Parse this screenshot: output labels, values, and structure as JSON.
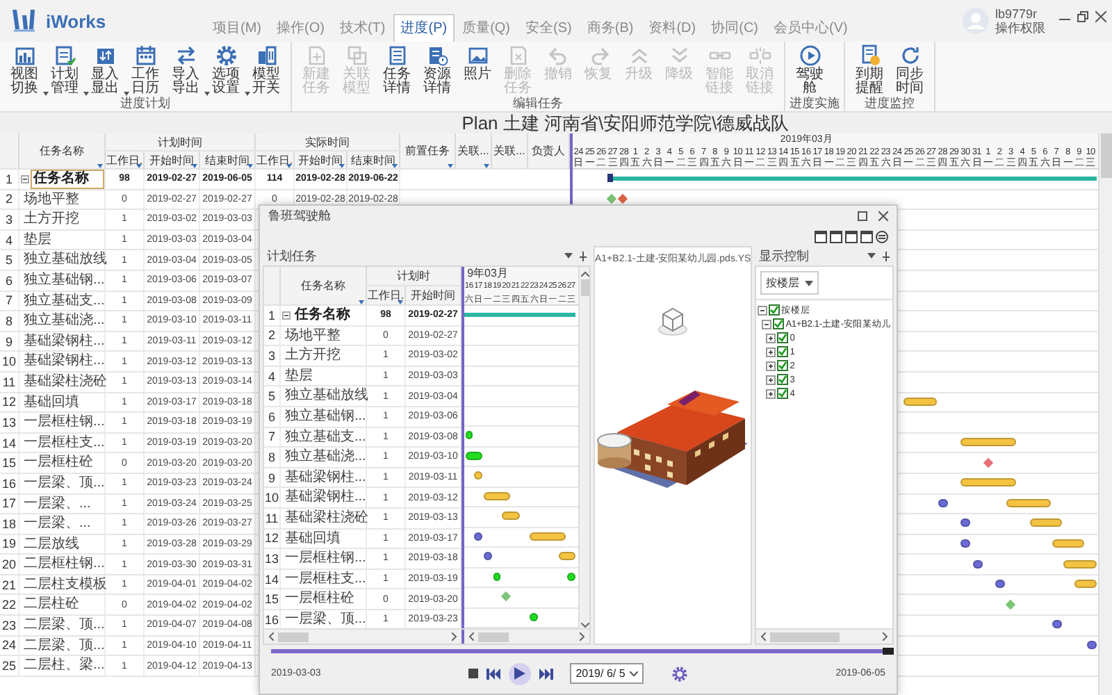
{
  "app": {
    "name": "iWorks"
  },
  "menu_tabs": [
    {
      "label": "项目(M)",
      "selected": false
    },
    {
      "label": "操作(O)",
      "selected": false
    },
    {
      "label": "技术(T)",
      "selected": false
    },
    {
      "label": "进度(P)",
      "selected": true
    },
    {
      "label": "质量(Q)",
      "selected": false
    },
    {
      "label": "安全(S)",
      "selected": false
    },
    {
      "label": "商务(B)",
      "selected": false
    },
    {
      "label": "资料(D)",
      "selected": false
    },
    {
      "label": "协同(C)",
      "selected": false
    },
    {
      "label": "会员中心(V)",
      "selected": false
    }
  ],
  "user": {
    "name": "lb9779r",
    "role": "操作权限"
  },
  "ribbon_groups": [
    {
      "label": "进度计划",
      "buttons": [
        {
          "label": "视图切换",
          "disabled": false,
          "dropdown": true
        },
        {
          "label": "计划管理",
          "disabled": false,
          "dropdown": true
        },
        {
          "label": "显入显出",
          "disabled": false,
          "dropdown": true
        },
        {
          "label": "工作日历",
          "disabled": false,
          "dropdown": false
        },
        {
          "label": "导入导出",
          "disabled": false,
          "dropdown": true
        },
        {
          "label": "选项设置",
          "disabled": false,
          "dropdown": true
        },
        {
          "label": "模型开关",
          "disabled": false,
          "dropdown": false
        }
      ]
    },
    {
      "label": "编辑任务",
      "buttons": [
        {
          "label": "新建任务",
          "disabled": true,
          "dropdown": false
        },
        {
          "label": "关联模型",
          "disabled": true,
          "dropdown": false
        },
        {
          "label": "任务详情",
          "disabled": false,
          "dropdown": false
        },
        {
          "label": "资源详情",
          "disabled": false,
          "dropdown": false
        },
        {
          "label": "照片",
          "disabled": false,
          "dropdown": false
        },
        {
          "label": "删除任务",
          "disabled": true,
          "dropdown": false
        },
        {
          "label": "撤销",
          "disabled": true,
          "dropdown": false
        },
        {
          "label": "恢复",
          "disabled": true,
          "dropdown": false
        },
        {
          "label": "升级",
          "disabled": true,
          "dropdown": false
        },
        {
          "label": "降级",
          "disabled": true,
          "dropdown": false
        },
        {
          "label": "智能链接",
          "disabled": true,
          "dropdown": false
        },
        {
          "label": "取消链接",
          "disabled": true,
          "dropdown": false
        }
      ]
    },
    {
      "label": "进度实施",
      "buttons": [
        {
          "label": "驾驶舱",
          "disabled": false,
          "dropdown": false
        }
      ]
    },
    {
      "label": "进度监控",
      "buttons": [
        {
          "label": "到期提醒",
          "disabled": false,
          "dropdown": false
        },
        {
          "label": "同步时间",
          "disabled": false,
          "dropdown": false
        }
      ]
    }
  ],
  "plan_title": "Plan 土建 河南省\\安阳师范学院\\德威战队",
  "plan_grid": {
    "columns": [
      {
        "kind": "number"
      },
      {
        "kind": "text",
        "label": "任务名称",
        "filter": true
      },
      {
        "kind": "group",
        "label": "计划时间",
        "children": [
          {
            "label": "工作日.",
            "filter": true
          },
          {
            "label": "开始时间",
            "filter": true
          },
          {
            "label": "结束时间",
            "filter": true
          }
        ]
      },
      {
        "kind": "group",
        "label": "实际时间",
        "children": [
          {
            "label": "工作日.",
            "filter": true
          },
          {
            "label": "开始时间",
            "filter": true
          },
          {
            "label": "结束时间",
            "filter": true
          }
        ]
      },
      {
        "kind": "text",
        "label": "前置任务",
        "filter": true
      },
      {
        "kind": "text",
        "label": "关联...",
        "filter": true
      },
      {
        "kind": "text",
        "label": "关联...",
        "filter": false
      },
      {
        "kind": "text",
        "label": "负责人",
        "filter": false
      }
    ],
    "timeline": {
      "months": [
        {
          "label": "2019年03月"
        }
      ],
      "days": [
        {
          "day": "24",
          "weekday": "日"
        },
        {
          "day": "25",
          "weekday": "一"
        },
        {
          "day": "26",
          "weekday": "二"
        },
        {
          "day": "27",
          "weekday": "三"
        },
        {
          "day": "28",
          "weekday": "四"
        },
        {
          "day": "1",
          "weekday": "五"
        },
        {
          "day": "2",
          "weekday": "六"
        },
        {
          "day": "3",
          "weekday": "日"
        },
        {
          "day": "4",
          "weekday": "一"
        },
        {
          "day": "5",
          "weekday": "二"
        },
        {
          "day": "6",
          "weekday": "三"
        },
        {
          "day": "7",
          "weekday": "四"
        },
        {
          "day": "8",
          "weekday": "五"
        },
        {
          "day": "9",
          "weekday": "六"
        },
        {
          "day": "10",
          "weekday": "日"
        },
        {
          "day": "11",
          "weekday": "一"
        },
        {
          "day": "12",
          "weekday": "二"
        },
        {
          "day": "13",
          "weekday": "三"
        },
        {
          "day": "14",
          "weekday": "四"
        },
        {
          "day": "15",
          "weekday": "五"
        },
        {
          "day": "16",
          "weekday": "六"
        },
        {
          "day": "17",
          "weekday": "日"
        },
        {
          "day": "18",
          "weekday": "一"
        },
        {
          "day": "19",
          "weekday": "二"
        },
        {
          "day": "20",
          "weekday": "三"
        },
        {
          "day": "21",
          "weekday": "四"
        },
        {
          "day": "22",
          "weekday": "五"
        },
        {
          "day": "23",
          "weekday": "六"
        },
        {
          "day": "24",
          "weekday": "日"
        },
        {
          "day": "25",
          "weekday": "一"
        },
        {
          "day": "26",
          "weekday": "二"
        },
        {
          "day": "27",
          "weekday": "三"
        },
        {
          "day": "28",
          "weekday": "四"
        },
        {
          "day": "29",
          "weekday": "五"
        },
        {
          "day": "30",
          "weekday": "六"
        },
        {
          "day": "31",
          "weekday": "日"
        },
        {
          "day": "1",
          "weekday": "一"
        },
        {
          "day": "2",
          "weekday": "二"
        },
        {
          "day": "3",
          "weekday": "三"
        },
        {
          "day": "4",
          "weekday": "四"
        },
        {
          "day": "5",
          "weekday": "五"
        },
        {
          "day": "6",
          "weekday": "六"
        },
        {
          "day": "7",
          "weekday": "日"
        },
        {
          "day": "8",
          "weekday": "一"
        },
        {
          "day": "9",
          "weekday": "二"
        },
        {
          "day": "10",
          "weekday": "三"
        }
      ]
    },
    "rows": [
      {
        "number": "1",
        "name": "任务名称",
        "summary": true,
        "selected": true,
        "cells": [
          "98",
          "2019-02-27",
          "2019-06-05",
          "114",
          "2019-02-28",
          "2019-06-22"
        ],
        "bars": [
          {
            "kind": "summary",
            "color": "#2bb5a4"
          }
        ]
      },
      {
        "number": "2",
        "name": "场地平整",
        "summary": false,
        "selected": false,
        "cells": [
          "0",
          "2019-02-27",
          "2019-02-27",
          "0",
          "2019-02-28",
          "2019-02-28"
        ],
        "bars": [
          {
            "kind": "milestone",
            "color": "#7cc576"
          },
          {
            "kind": "milestone",
            "color": "#e0664a"
          }
        ]
      },
      {
        "number": "3",
        "name": "土方开挖",
        "summary": false,
        "selected": false,
        "cells": [
          "1",
          "2019-03-02",
          "2019-03-03"
        ],
        "bars": []
      },
      {
        "number": "4",
        "name": "垫层",
        "summary": false,
        "selected": false,
        "cells": [
          "1",
          "2019-03-03",
          "2019-03-04"
        ],
        "bars": []
      },
      {
        "number": "5",
        "name": "独立基础放线",
        "summary": false,
        "selected": false,
        "cells": [
          "1",
          "2019-03-04",
          "2019-03-05"
        ],
        "bars": []
      },
      {
        "number": "6",
        "name": "独立基础钢...",
        "summary": false,
        "selected": false,
        "cells": [
          "1",
          "2019-03-06",
          "2019-03-07"
        ],
        "bars": []
      },
      {
        "number": "7",
        "name": "独立基础支...",
        "summary": false,
        "selected": false,
        "cells": [
          "1",
          "2019-03-08",
          "2019-03-09"
        ],
        "bars": []
      },
      {
        "number": "8",
        "name": "独立基础浇...",
        "summary": false,
        "selected": false,
        "cells": [
          "1",
          "2019-03-10",
          "2019-03-11"
        ],
        "bars": []
      },
      {
        "number": "9",
        "name": "基础梁钢柱...",
        "summary": false,
        "selected": false,
        "cells": [
          "1",
          "2019-03-11",
          "2019-03-12"
        ],
        "bars": []
      },
      {
        "number": "10",
        "name": "基础梁钢柱...",
        "summary": false,
        "selected": false,
        "cells": [
          "1",
          "2019-03-12",
          "2019-03-13"
        ],
        "bars": []
      },
      {
        "number": "11",
        "name": "基础梁柱浇砼",
        "summary": false,
        "selected": false,
        "cells": [
          "1",
          "2019-03-13",
          "2019-03-14"
        ],
        "bars": []
      },
      {
        "number": "12",
        "name": "基础回填",
        "summary": false,
        "selected": false,
        "cells": [
          "1",
          "2019-03-17",
          "2019-03-18"
        ],
        "bars": [
          {
            "kind": "task",
            "color": "#f5c342"
          }
        ]
      },
      {
        "number": "13",
        "name": "一层框柱钢...",
        "summary": false,
        "selected": false,
        "cells": [
          "1",
          "2019-03-18",
          "2019-03-19"
        ],
        "bars": []
      },
      {
        "number": "14",
        "name": "一层框柱支...",
        "summary": false,
        "selected": false,
        "cells": [
          "1",
          "2019-03-19",
          "2019-03-20"
        ],
        "bars": [
          {
            "kind": "task",
            "color": "#f5c342"
          }
        ]
      },
      {
        "number": "15",
        "name": "一层框柱砼",
        "summary": false,
        "selected": false,
        "cells": [
          "0",
          "2019-03-20",
          "2019-03-20"
        ],
        "bars": [
          {
            "kind": "milestone",
            "color": "#e8707a"
          }
        ]
      },
      {
        "number": "16",
        "name": "一层梁、顶...",
        "summary": false,
        "selected": false,
        "cells": [
          "1",
          "2019-03-23",
          "2019-03-24"
        ],
        "bars": [
          {
            "kind": "task",
            "color": "#f5c342"
          }
        ]
      },
      {
        "number": "17",
        "name": "一层梁、...",
        "summary": false,
        "selected": false,
        "cells": [
          "1",
          "2019-03-24",
          "2019-03-25"
        ],
        "bars": [
          {
            "kind": "task",
            "color": "#6b6bd6"
          },
          {
            "kind": "task",
            "color": "#f5c342"
          }
        ]
      },
      {
        "number": "18",
        "name": "一层梁、...",
        "summary": false,
        "selected": false,
        "cells": [
          "1",
          "2019-03-26",
          "2019-03-27"
        ],
        "bars": [
          {
            "kind": "task",
            "color": "#6b6bd6"
          },
          {
            "kind": "task",
            "color": "#f5c342"
          }
        ]
      },
      {
        "number": "19",
        "name": "二层放线",
        "summary": false,
        "selected": false,
        "cells": [
          "1",
          "2019-03-28",
          "2019-03-29"
        ],
        "bars": [
          {
            "kind": "task",
            "color": "#6b6bd6"
          },
          {
            "kind": "task",
            "color": "#f5c342"
          }
        ]
      },
      {
        "number": "20",
        "name": "二层框柱钢...",
        "summary": false,
        "selected": false,
        "cells": [
          "1",
          "2019-03-30",
          "2019-03-31"
        ],
        "bars": [
          {
            "kind": "task",
            "color": "#6b6bd6"
          },
          {
            "kind": "task",
            "color": "#f5c342"
          }
        ]
      },
      {
        "number": "21",
        "name": "二层柱支模板",
        "summary": false,
        "selected": false,
        "cells": [
          "1",
          "2019-04-01",
          "2019-04-02"
        ],
        "bars": [
          {
            "kind": "task",
            "color": "#6b6bd6"
          },
          {
            "kind": "task",
            "color": "#f5c342"
          }
        ]
      },
      {
        "number": "22",
        "name": "二层柱砼",
        "summary": false,
        "selected": false,
        "cells": [
          "0",
          "2019-04-02",
          "2019-04-02"
        ],
        "bars": [
          {
            "kind": "milestone",
            "color": "#7cc576"
          }
        ]
      },
      {
        "number": "23",
        "name": "二层梁、顶...",
        "summary": false,
        "selected": false,
        "cells": [
          "1",
          "2019-04-07",
          "2019-04-08"
        ],
        "bars": [
          {
            "kind": "task",
            "color": "#6b6bd6"
          }
        ]
      },
      {
        "number": "24",
        "name": "二层梁、顶...",
        "summary": false,
        "selected": false,
        "cells": [
          "1",
          "2019-04-10",
          "2019-04-11"
        ],
        "bars": [
          {
            "kind": "task",
            "color": "#6b6bd6"
          }
        ]
      },
      {
        "number": "25",
        "name": "二层柱、梁...",
        "summary": false,
        "selected": false,
        "cells": [
          "1",
          "2019-04-12",
          "2019-04-13"
        ],
        "bars": []
      }
    ]
  },
  "cockpit": {
    "title": "鲁班驾驶舱",
    "task_panel": {
      "title": "计划任务",
      "columns": [
        {
          "kind": "number"
        },
        {
          "kind": "text",
          "label": "任务名称",
          "filter": true
        },
        {
          "kind": "group",
          "label": "计划时",
          "children": [
            {
              "label": "工作日.",
              "filter": true
            },
            {
              "label": "开始时间",
              "filter": false
            }
          ]
        }
      ],
      "timeline": {
        "months": [
          {
            "label": "9年03月"
          }
        ],
        "days": [
          {
            "day": "16",
            "weekday": "六"
          },
          {
            "day": "17",
            "weekday": "日"
          },
          {
            "day": "18",
            "weekday": "一"
          },
          {
            "day": "19",
            "weekday": "二"
          },
          {
            "day": "20",
            "weekday": "三"
          },
          {
            "day": "21",
            "weekday": "四"
          },
          {
            "day": "22",
            "weekday": "五"
          },
          {
            "day": "23",
            "weekday": "六"
          },
          {
            "day": "24",
            "weekday": "日"
          },
          {
            "day": "25",
            "weekday": "一"
          },
          {
            "day": "26",
            "weekday": "二"
          },
          {
            "day": "27",
            "weekday": "三"
          }
        ]
      },
      "rows": [
        {
          "number": "1",
          "name": "任务名称",
          "summary": true,
          "selected": false,
          "cells": [
            "98",
            "2019-02-27"
          ],
          "bars": [
            {
              "kind": "summary",
              "color": "#2bb5a4"
            }
          ]
        },
        {
          "number": "2",
          "name": "场地平整",
          "summary": false,
          "selected": false,
          "cells": [
            "0",
            "2019-02-27"
          ],
          "bars": []
        },
        {
          "number": "3",
          "name": "土方开挖",
          "summary": false,
          "selected": false,
          "cells": [
            "1",
            "2019-03-02"
          ],
          "bars": []
        },
        {
          "number": "4",
          "name": "垫层",
          "summary": false,
          "selected": false,
          "cells": [
            "1",
            "2019-03-03"
          ],
          "bars": []
        },
        {
          "number": "5",
          "name": "独立基础放线",
          "summary": false,
          "selected": false,
          "cells": [
            "1",
            "2019-03-04"
          ],
          "bars": []
        },
        {
          "number": "6",
          "name": "独立基础钢...",
          "summary": false,
          "selected": false,
          "cells": [
            "1",
            "2019-03-06"
          ],
          "bars": []
        },
        {
          "number": "7",
          "name": "独立基础支...",
          "summary": false,
          "selected": false,
          "cells": [
            "1",
            "2019-03-08"
          ],
          "bars": [
            {
              "kind": "task",
              "color": "#22dd22"
            }
          ]
        },
        {
          "number": "8",
          "name": "独立基础浇...",
          "summary": false,
          "selected": false,
          "cells": [
            "1",
            "2019-03-10"
          ],
          "bars": [
            {
              "kind": "task",
              "color": "#22dd22"
            }
          ]
        },
        {
          "number": "9",
          "name": "基础梁钢柱...",
          "summary": false,
          "selected": false,
          "cells": [
            "1",
            "2019-03-11"
          ],
          "bars": [
            {
              "kind": "task",
              "color": "#f5c342"
            }
          ]
        },
        {
          "number": "10",
          "name": "基础梁钢柱...",
          "summary": false,
          "selected": false,
          "cells": [
            "1",
            "2019-03-12"
          ],
          "bars": [
            {
              "kind": "task",
              "color": "#f5c342"
            }
          ]
        },
        {
          "number": "11",
          "name": "基础梁柱浇砼",
          "summary": false,
          "selected": false,
          "cells": [
            "1",
            "2019-03-13"
          ],
          "bars": [
            {
              "kind": "task",
              "color": "#f5c342"
            }
          ]
        },
        {
          "number": "12",
          "name": "基础回填",
          "summary": false,
          "selected": false,
          "cells": [
            "1",
            "2019-03-17"
          ],
          "bars": [
            {
              "kind": "task",
              "color": "#6b6bd6"
            },
            {
              "kind": "task",
              "color": "#f5c342"
            }
          ]
        },
        {
          "number": "13",
          "name": "一层框柱钢...",
          "summary": false,
          "selected": false,
          "cells": [
            "1",
            "2019-03-18"
          ],
          "bars": [
            {
              "kind": "task",
              "color": "#6b6bd6"
            },
            {
              "kind": "task",
              "color": "#f5c342"
            }
          ]
        },
        {
          "number": "14",
          "name": "一层框柱支...",
          "summary": false,
          "selected": false,
          "cells": [
            "1",
            "2019-03-19"
          ],
          "bars": [
            {
              "kind": "task",
              "color": "#22dd22"
            },
            {
              "kind": "task",
              "color": "#22dd22"
            }
          ]
        },
        {
          "number": "15",
          "name": "一层框柱砼",
          "summary": false,
          "selected": false,
          "cells": [
            "0",
            "2019-03-20"
          ],
          "bars": [
            {
              "kind": "milestone",
              "color": "#7cc576"
            }
          ]
        },
        {
          "number": "16",
          "name": "一层梁、顶...",
          "summary": false,
          "selected": false,
          "cells": [
            "1",
            "2019-03-23"
          ],
          "bars": [
            {
              "kind": "task",
              "color": "#22dd22"
            }
          ]
        }
      ]
    },
    "model_view": {
      "title": "A1+B2.1-土建-安阳某幼儿园.pds.YS"
    },
    "display_panel": {
      "title": "显示控制",
      "mode": "按楼层",
      "tree": [
        {
          "label": "按楼层",
          "checked": true,
          "expanded": true,
          "children": [
            {
              "label": "A1+B2.1-土建-安阳某幼儿",
              "checked": true,
              "expanded": true,
              "children": [
                {
                  "label": "0",
                  "checked": true,
                  "expanded": false
                },
                {
                  "label": "1",
                  "checked": true,
                  "expanded": false
                },
                {
                  "label": "2",
                  "checked": true,
                  "expanded": false
                },
                {
                  "label": "3",
                  "checked": true,
                  "expanded": false
                },
                {
                  "label": "4",
                  "checked": true,
                  "expanded": false
                }
              ]
            }
          ]
        }
      ]
    },
    "playback": {
      "start_date": "2019-03-03",
      "end_date": "2019-06-05",
      "level": 1,
      "current_date": "2019/ 6/ 5"
    }
  }
}
